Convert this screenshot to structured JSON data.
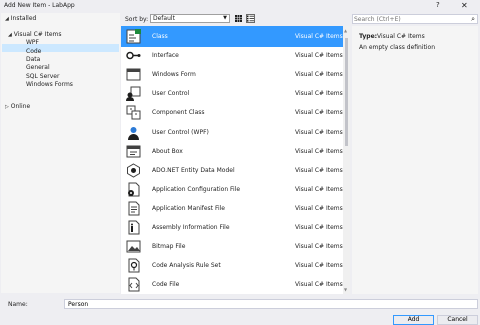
{
  "window": {
    "title": "Add New Item - LabApp",
    "help_label": "?",
    "close_label": "✕"
  },
  "tree": {
    "installed_label": "Installed",
    "visual_csharp_label": "Visual C# Items",
    "children": [
      "WPF",
      "Code",
      "Data",
      "General",
      "SQL Server",
      "Windows Forms"
    ],
    "online_label": "Online"
  },
  "toolbar": {
    "sort_label": "Sort by:",
    "sort_value": "Default"
  },
  "search": {
    "placeholder": "Search (Ctrl+E)",
    "icon": "search-icon"
  },
  "templates": [
    {
      "name": "Class",
      "category": "Visual C# Items",
      "icon": "class-icon",
      "selected": true
    },
    {
      "name": "Interface",
      "category": "Visual C# Items",
      "icon": "interface-icon"
    },
    {
      "name": "Windows Form",
      "category": "Visual C# Items",
      "icon": "windows-form-icon"
    },
    {
      "name": "User Control",
      "category": "Visual C# Items",
      "icon": "user-control-icon"
    },
    {
      "name": "Component Class",
      "category": "Visual C# Items",
      "icon": "component-class-icon"
    },
    {
      "name": "User Control (WPF)",
      "category": "Visual C# Items",
      "icon": "user-control-wpf-icon"
    },
    {
      "name": "About Box",
      "category": "Visual C# Items",
      "icon": "about-box-icon"
    },
    {
      "name": "ADO.NET Entity Data Model",
      "category": "Visual C# Items",
      "icon": "entity-model-icon"
    },
    {
      "name": "Application Configuration File",
      "category": "Visual C# Items",
      "icon": "config-file-icon"
    },
    {
      "name": "Application Manifest File",
      "category": "Visual C# Items",
      "icon": "manifest-file-icon"
    },
    {
      "name": "Assembly Information File",
      "category": "Visual C# Items",
      "icon": "assembly-info-icon"
    },
    {
      "name": "Bitmap File",
      "category": "Visual C# Items",
      "icon": "bitmap-file-icon"
    },
    {
      "name": "Code Analysis Rule Set",
      "category": "Visual C# Items",
      "icon": "rule-set-icon"
    },
    {
      "name": "Code File",
      "category": "Visual C# Items",
      "icon": "code-file-icon"
    }
  ],
  "details": {
    "type_label": "Type:",
    "type_value": "Visual C# Items",
    "description": "An empty class definition"
  },
  "name_field": {
    "label": "Name:",
    "value": "Person"
  },
  "buttons": {
    "add": "Add",
    "cancel": "Cancel"
  },
  "colors": {
    "selection": "#3399ff",
    "tree_selection": "#cce8ff",
    "window_bg": "#eeeef2"
  }
}
